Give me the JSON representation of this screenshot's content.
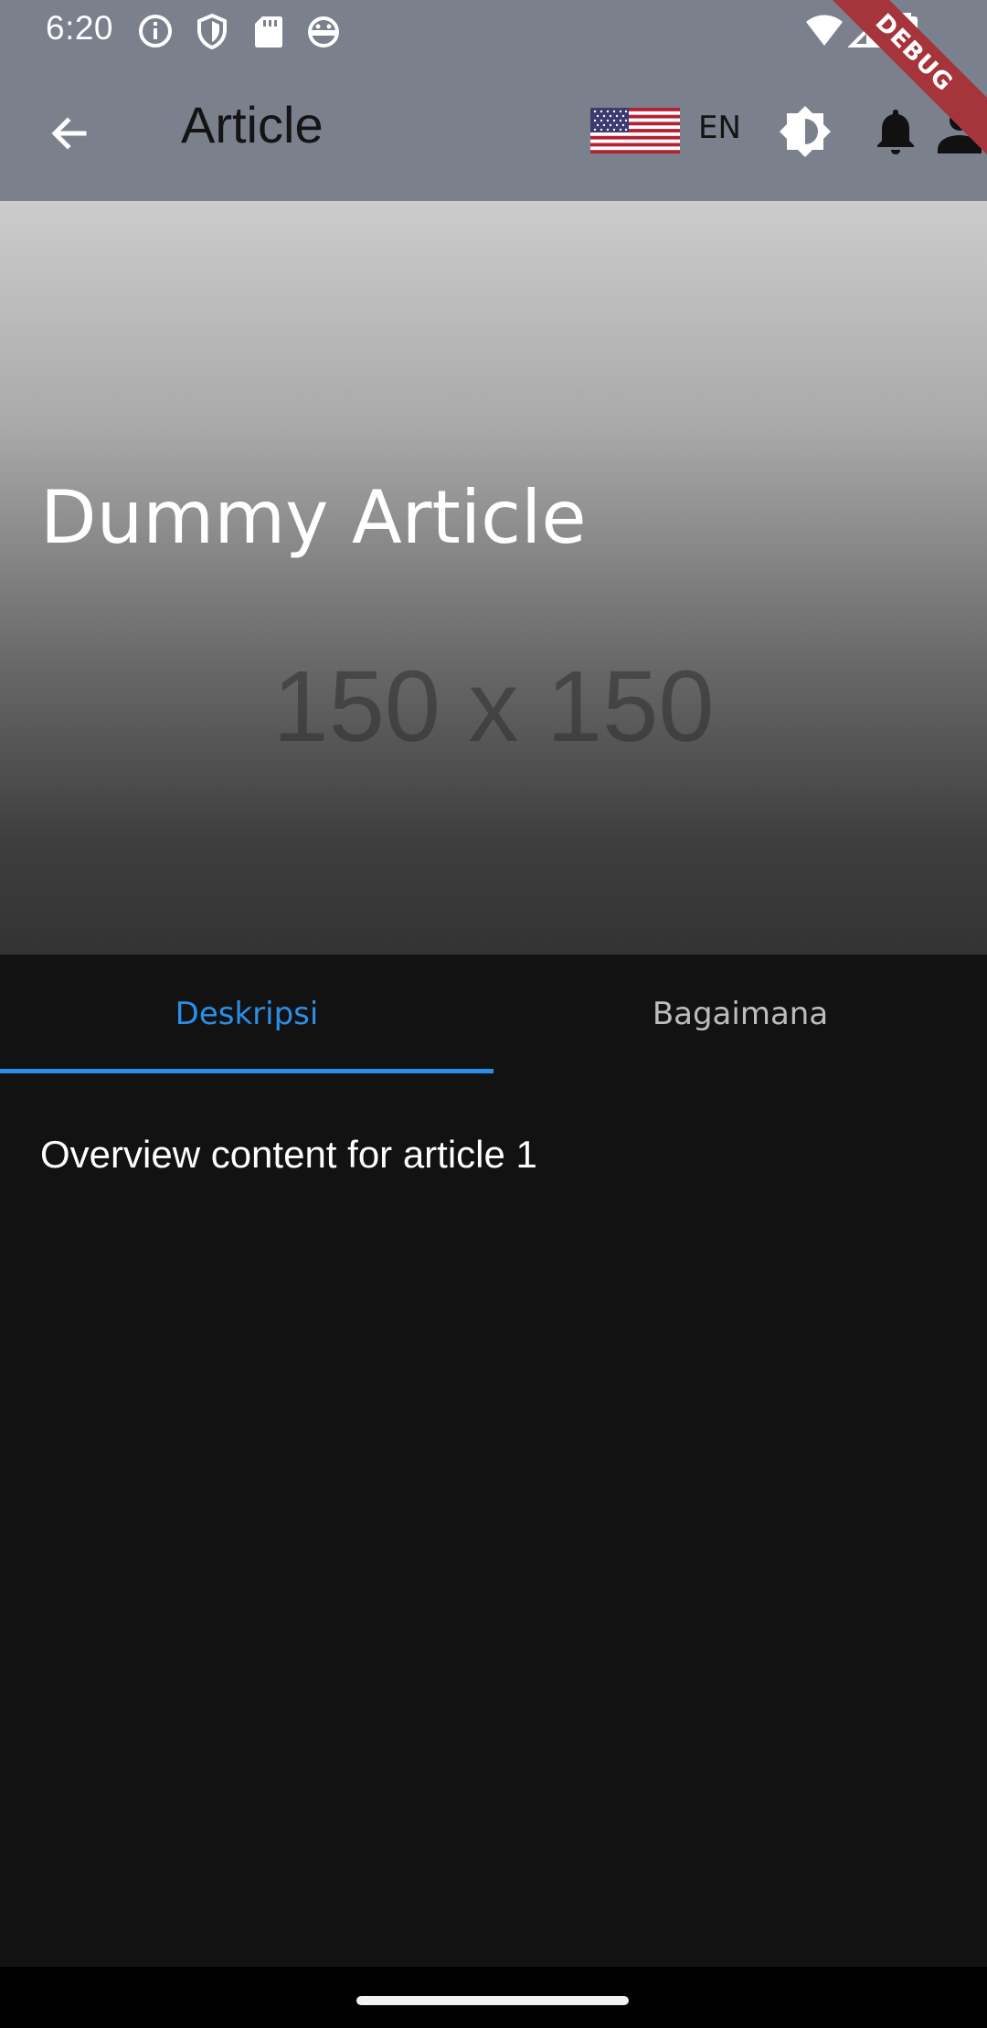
{
  "status_bar": {
    "time": "6:20",
    "icons": [
      "info-icon",
      "shield-icon",
      "sd-card-icon",
      "android-icon",
      "wifi-icon",
      "signal-icon",
      "battery-icon"
    ]
  },
  "toolbar": {
    "title": "Article",
    "language_label": "EN",
    "icons": [
      "back-arrow-icon",
      "us-flag-icon",
      "brightness-icon",
      "bell-icon",
      "person-icon"
    ]
  },
  "debug_banner": "DEBUG",
  "hero": {
    "title": "Dummy Article",
    "placeholder_text": "150 x 150"
  },
  "tabs": [
    {
      "label": "Deskripsi",
      "active": true
    },
    {
      "label": "Bagaimana",
      "active": false
    }
  ],
  "content": {
    "text": "Overview content for article 1"
  },
  "colors": {
    "app_bar": "#7b808d",
    "accent": "#2b8ee8",
    "background": "#121212",
    "debug_ribbon": "#a5343b"
  }
}
